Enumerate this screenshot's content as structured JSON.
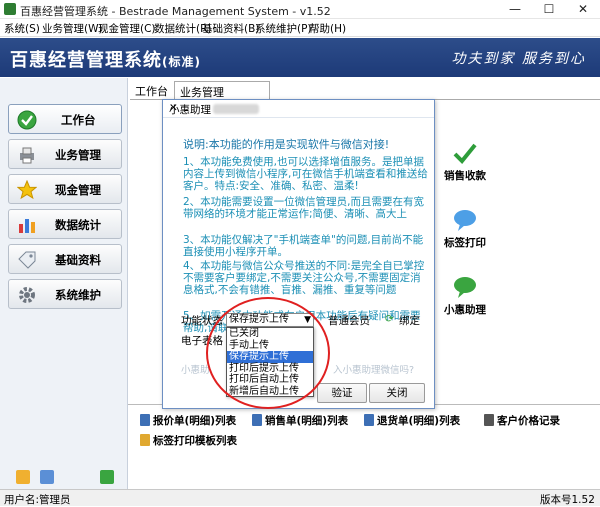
{
  "window": {
    "title": "百惠经营管理系统 - Bestrade Management System - v1.52",
    "minimize": "—",
    "maximize": "☐",
    "close": "✕"
  },
  "menu": [
    "系统(S)",
    "业务管理(W)",
    "现金管理(C)",
    "数据统计(R)",
    "基础资料(B)",
    "系统维护(P)",
    "帮助(H)"
  ],
  "header": {
    "logo": "百惠经营管理系统",
    "edition": "(标准)",
    "slogan": "功夫到家 服务到心"
  },
  "sidebar": {
    "items": [
      {
        "label": "工作台",
        "icon": "check-circle-icon"
      },
      {
        "label": "业务管理",
        "icon": "printer-icon"
      },
      {
        "label": "现金管理",
        "icon": "star-icon"
      },
      {
        "label": "数据统计",
        "icon": "bar-chart-icon"
      },
      {
        "label": "基础资料",
        "icon": "tag-icon"
      },
      {
        "label": "系统维护",
        "icon": "gear-icon"
      }
    ]
  },
  "tabs": [
    {
      "label": "工作台"
    },
    {
      "label": "业务管理"
    }
  ],
  "right_shortcuts": [
    {
      "label": "销售收款",
      "icon": "checkmark-icon"
    },
    {
      "label": "标签打印",
      "icon": "chat-bubble-icon"
    },
    {
      "label": "小惠助理",
      "icon": "assistant-icon"
    }
  ],
  "bottom_links": [
    "报价单(明细)列表",
    "销售单(明细)列表",
    "退货单(明细)列表",
    "客户价格记录",
    "标签打印模板列表"
  ],
  "status": {
    "user": "用户名:管理员",
    "version": "版本号1.52"
  },
  "dialog": {
    "title": "小惠助理",
    "close": "✕",
    "note": "说明:本功能的作用是实现软件与微信对接!",
    "items": [
      "1、本功能免费使用,也可以选择增值服务。是把单据内容上传到微信小程序,可在微信手机端查看和推送给客户。特点:安全、准确、私密、温柔!",
      "2、本功能需要设置一位微信管理员,而且需要在有宽带网络的环境才能正常运作;简便、清晰、高大上",
      "3、本功能仅解决了\"手机端查单\"的问题,目前尚不能直接使用小程序开单。",
      "4、本功能与微信公众号推送的不同:是完全自已掌控不需要客户要绑定,不需要关注公众号,不需要固定消息格式,不会有错推、盲推、漏推、重复等问题",
      "5、如需开通本功能或在启用本功能后有疑问和需要帮助,请联系客服为您服务!"
    ],
    "status_label": "功能状态",
    "status_value": "保存提示上传",
    "options": [
      "已关闭",
      "手动上传",
      "保存提示上传",
      "打印后提示上传",
      "打印后自动上传",
      "新增后自动上传"
    ],
    "selected_index": 2,
    "member_label": "普通会员",
    "bind_label": "绑定",
    "excel_label": "电子表格",
    "faint_left": "小惠助",
    "faint_right": "入小惠助理微信吗?",
    "verify_button": "验证",
    "close_button": "关闭"
  },
  "colors": {
    "header_bg": "#1d3a78",
    "dialog_text": "#1b8fb5",
    "selection": "#2f6fd6",
    "annotation": "#e02020"
  }
}
